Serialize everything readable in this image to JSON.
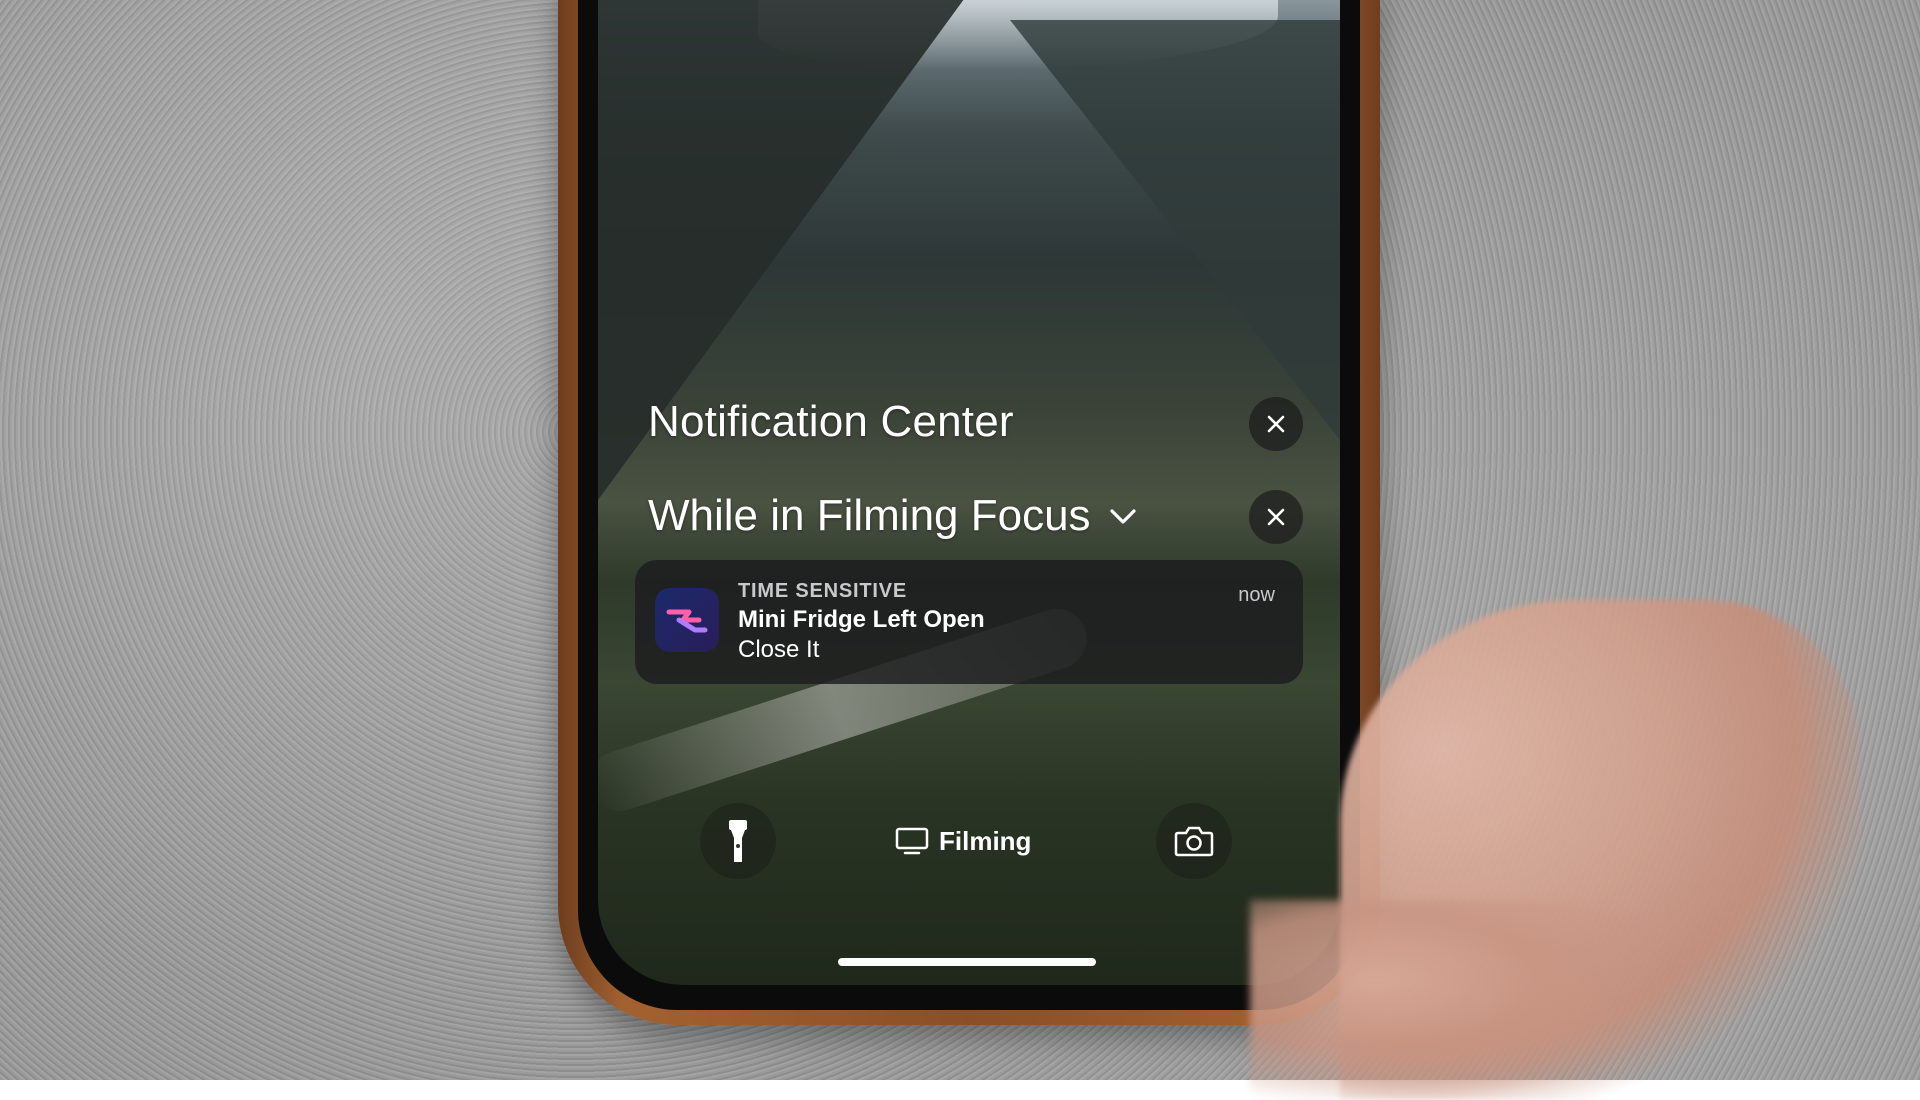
{
  "lock_screen": {
    "notification_center_title": "Notification Center",
    "focus_group_title": "While in Filming Focus",
    "notification": {
      "eyebrow": "TIME SENSITIVE",
      "title": "Mini Fridge Left Open",
      "body": "Close It",
      "time": "now",
      "app_icon": "shortcuts-app-icon"
    },
    "focus_pill": {
      "label": "Filming",
      "icon": "tv-icon"
    },
    "icons": {
      "close": "close-icon",
      "chevron": "chevron-down-icon",
      "flashlight": "flashlight-icon",
      "camera": "camera-icon"
    }
  }
}
